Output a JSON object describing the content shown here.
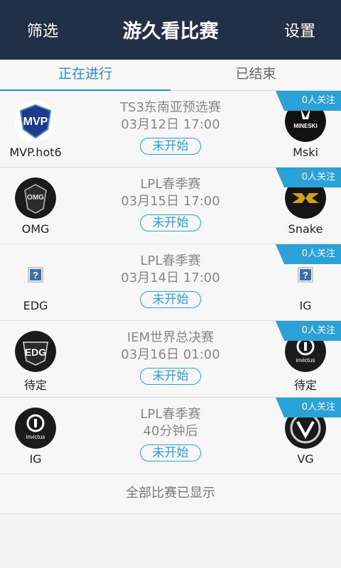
{
  "topbar": {
    "left_label": "筛选",
    "title": "游久看比赛",
    "right_label": "设置"
  },
  "tabs": [
    {
      "label": "正在进行",
      "active": true
    },
    {
      "label": "已结束",
      "active": false
    }
  ],
  "matches": [
    {
      "event": "TS3东南亚预选赛",
      "time": "03月12日 17:00",
      "status": "未开始",
      "followers": "0人关注",
      "team_left": {
        "name": "MVP.hot6",
        "logo": "mvp-logo"
      },
      "team_right": {
        "name": "Mski",
        "logo": "mineski-logo"
      }
    },
    {
      "event": "LPL春季赛",
      "time": "03月15日 17:00",
      "status": "未开始",
      "followers": "0人关注",
      "team_left": {
        "name": "OMG",
        "logo": "omg-logo"
      },
      "team_right": {
        "name": "Snake",
        "logo": "snake-logo"
      }
    },
    {
      "event": "LPL春季赛",
      "time": "03月14日 17:00",
      "status": "未开始",
      "followers": "0人关注",
      "team_left": {
        "name": "EDG",
        "logo": "missing-image-icon"
      },
      "team_right": {
        "name": "IG",
        "logo": "missing-image-icon"
      }
    },
    {
      "event": "IEM世界总决赛",
      "time": "03月16日 01:00",
      "status": "未开始",
      "followers": "0人关注",
      "team_left": {
        "name": "待定",
        "logo": "edg-logo"
      },
      "team_right": {
        "name": "待定",
        "logo": "invictus-gaming-logo"
      }
    },
    {
      "event": "LPL春季赛",
      "time": "40分钟后",
      "status": "未开始",
      "followers": "0人关注",
      "team_left": {
        "name": "IG",
        "logo": "invictus-gaming-logo"
      },
      "team_right": {
        "name": "VG",
        "logo": "vg-logo"
      }
    }
  ],
  "footer": {
    "text": "全部比赛已显示"
  },
  "colors": {
    "header_bg": "#223047",
    "accent": "#2a8fc8",
    "ribbon": "#2aa2d8",
    "status": "#2aa2d8"
  }
}
